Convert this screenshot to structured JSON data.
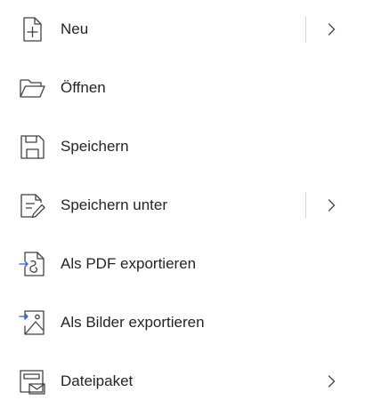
{
  "menu": {
    "items": [
      {
        "label": "Neu",
        "icon": "new-document-icon",
        "has_submenu": true,
        "has_divider": true
      },
      {
        "label": "Öffnen",
        "icon": "folder-open-icon",
        "has_submenu": false,
        "has_divider": false
      },
      {
        "label": "Speichern",
        "icon": "save-icon",
        "has_submenu": false,
        "has_divider": false
      },
      {
        "label": "Speichern unter",
        "icon": "save-as-icon",
        "has_submenu": true,
        "has_divider": true
      },
      {
        "label": "Als PDF exportieren",
        "icon": "export-pdf-icon",
        "has_submenu": false,
        "has_divider": false
      },
      {
        "label": "Als Bilder exportieren",
        "icon": "export-images-icon",
        "has_submenu": false,
        "has_divider": false
      },
      {
        "label": "Dateipaket",
        "icon": "file-package-icon",
        "has_submenu": true,
        "has_divider": false
      }
    ]
  },
  "colors": {
    "text": "#242424",
    "icon_stroke": "#424242",
    "accent": "#2f5fd0",
    "divider": "#d6d6d6"
  }
}
